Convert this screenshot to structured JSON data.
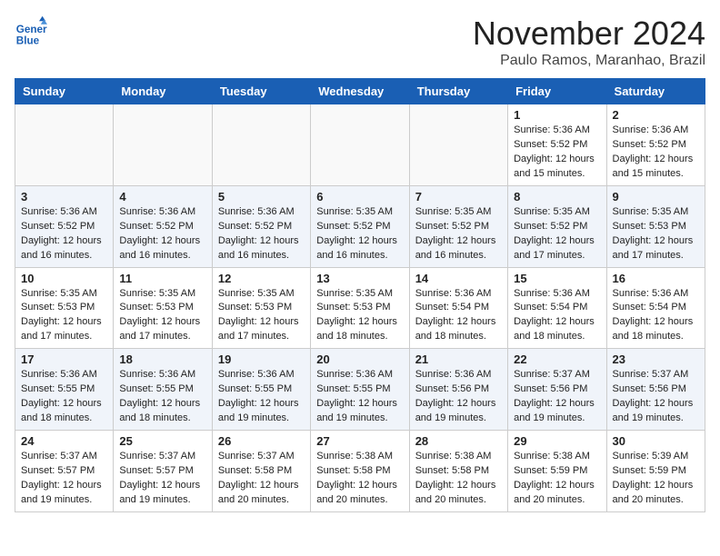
{
  "logo": {
    "line1": "General",
    "line2": "Blue"
  },
  "title": "November 2024",
  "subtitle": "Paulo Ramos, Maranhao, Brazil",
  "days_header": [
    "Sunday",
    "Monday",
    "Tuesday",
    "Wednesday",
    "Thursday",
    "Friday",
    "Saturday"
  ],
  "weeks": [
    [
      {
        "day": "",
        "info": ""
      },
      {
        "day": "",
        "info": ""
      },
      {
        "day": "",
        "info": ""
      },
      {
        "day": "",
        "info": ""
      },
      {
        "day": "",
        "info": ""
      },
      {
        "day": "1",
        "info": "Sunrise: 5:36 AM\nSunset: 5:52 PM\nDaylight: 12 hours and 15 minutes."
      },
      {
        "day": "2",
        "info": "Sunrise: 5:36 AM\nSunset: 5:52 PM\nDaylight: 12 hours and 15 minutes."
      }
    ],
    [
      {
        "day": "3",
        "info": "Sunrise: 5:36 AM\nSunset: 5:52 PM\nDaylight: 12 hours and 16 minutes."
      },
      {
        "day": "4",
        "info": "Sunrise: 5:36 AM\nSunset: 5:52 PM\nDaylight: 12 hours and 16 minutes."
      },
      {
        "day": "5",
        "info": "Sunrise: 5:36 AM\nSunset: 5:52 PM\nDaylight: 12 hours and 16 minutes."
      },
      {
        "day": "6",
        "info": "Sunrise: 5:35 AM\nSunset: 5:52 PM\nDaylight: 12 hours and 16 minutes."
      },
      {
        "day": "7",
        "info": "Sunrise: 5:35 AM\nSunset: 5:52 PM\nDaylight: 12 hours and 16 minutes."
      },
      {
        "day": "8",
        "info": "Sunrise: 5:35 AM\nSunset: 5:52 PM\nDaylight: 12 hours and 17 minutes."
      },
      {
        "day": "9",
        "info": "Sunrise: 5:35 AM\nSunset: 5:53 PM\nDaylight: 12 hours and 17 minutes."
      }
    ],
    [
      {
        "day": "10",
        "info": "Sunrise: 5:35 AM\nSunset: 5:53 PM\nDaylight: 12 hours and 17 minutes."
      },
      {
        "day": "11",
        "info": "Sunrise: 5:35 AM\nSunset: 5:53 PM\nDaylight: 12 hours and 17 minutes."
      },
      {
        "day": "12",
        "info": "Sunrise: 5:35 AM\nSunset: 5:53 PM\nDaylight: 12 hours and 17 minutes."
      },
      {
        "day": "13",
        "info": "Sunrise: 5:35 AM\nSunset: 5:53 PM\nDaylight: 12 hours and 18 minutes."
      },
      {
        "day": "14",
        "info": "Sunrise: 5:36 AM\nSunset: 5:54 PM\nDaylight: 12 hours and 18 minutes."
      },
      {
        "day": "15",
        "info": "Sunrise: 5:36 AM\nSunset: 5:54 PM\nDaylight: 12 hours and 18 minutes."
      },
      {
        "day": "16",
        "info": "Sunrise: 5:36 AM\nSunset: 5:54 PM\nDaylight: 12 hours and 18 minutes."
      }
    ],
    [
      {
        "day": "17",
        "info": "Sunrise: 5:36 AM\nSunset: 5:55 PM\nDaylight: 12 hours and 18 minutes."
      },
      {
        "day": "18",
        "info": "Sunrise: 5:36 AM\nSunset: 5:55 PM\nDaylight: 12 hours and 18 minutes."
      },
      {
        "day": "19",
        "info": "Sunrise: 5:36 AM\nSunset: 5:55 PM\nDaylight: 12 hours and 19 minutes."
      },
      {
        "day": "20",
        "info": "Sunrise: 5:36 AM\nSunset: 5:55 PM\nDaylight: 12 hours and 19 minutes."
      },
      {
        "day": "21",
        "info": "Sunrise: 5:36 AM\nSunset: 5:56 PM\nDaylight: 12 hours and 19 minutes."
      },
      {
        "day": "22",
        "info": "Sunrise: 5:37 AM\nSunset: 5:56 PM\nDaylight: 12 hours and 19 minutes."
      },
      {
        "day": "23",
        "info": "Sunrise: 5:37 AM\nSunset: 5:56 PM\nDaylight: 12 hours and 19 minutes."
      }
    ],
    [
      {
        "day": "24",
        "info": "Sunrise: 5:37 AM\nSunset: 5:57 PM\nDaylight: 12 hours and 19 minutes."
      },
      {
        "day": "25",
        "info": "Sunrise: 5:37 AM\nSunset: 5:57 PM\nDaylight: 12 hours and 19 minutes."
      },
      {
        "day": "26",
        "info": "Sunrise: 5:37 AM\nSunset: 5:58 PM\nDaylight: 12 hours and 20 minutes."
      },
      {
        "day": "27",
        "info": "Sunrise: 5:38 AM\nSunset: 5:58 PM\nDaylight: 12 hours and 20 minutes."
      },
      {
        "day": "28",
        "info": "Sunrise: 5:38 AM\nSunset: 5:58 PM\nDaylight: 12 hours and 20 minutes."
      },
      {
        "day": "29",
        "info": "Sunrise: 5:38 AM\nSunset: 5:59 PM\nDaylight: 12 hours and 20 minutes."
      },
      {
        "day": "30",
        "info": "Sunrise: 5:39 AM\nSunset: 5:59 PM\nDaylight: 12 hours and 20 minutes."
      }
    ]
  ]
}
